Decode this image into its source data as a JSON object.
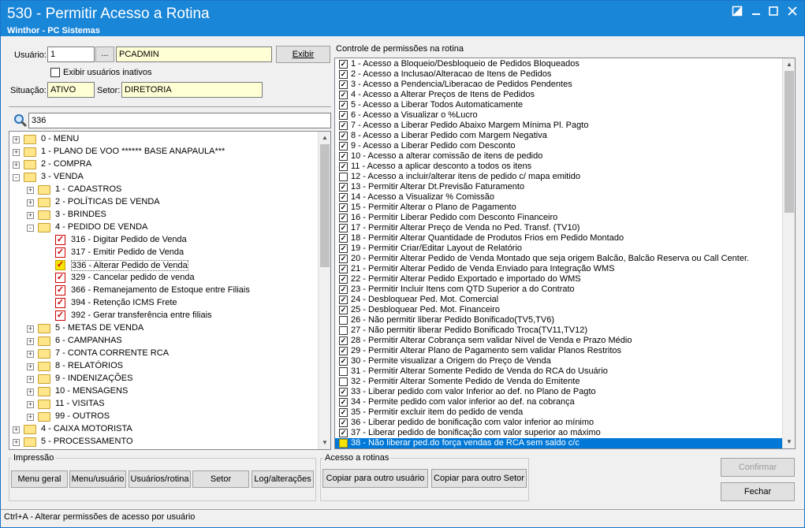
{
  "window": {
    "title": "530 - Permitir Acesso a Rotina",
    "subtitle": "Winthor - PC Sistemas"
  },
  "form": {
    "usuario_label": "Usuário:",
    "usuario_value": "1",
    "lookup_label": "...",
    "usuario_name": "PCADMIN",
    "exibir_label": "Exibir",
    "exibir_inativos_label": "Exibir usuários inativos",
    "situacao_label": "Situação:",
    "situacao_value": "ATIVO",
    "setor_label": "Setor:",
    "setor_value": "DIRETORIA",
    "search_value": "336"
  },
  "tree": [
    {
      "label": "0 - MENU",
      "level": 0,
      "type": "folder",
      "exp": "+"
    },
    {
      "label": "1 - PLANO DE VOO   ****** BASE ANAPAULA***",
      "level": 0,
      "type": "folder",
      "exp": "+"
    },
    {
      "label": "2 - COMPRA",
      "level": 0,
      "type": "folder",
      "exp": "+"
    },
    {
      "label": "3 - VENDA",
      "level": 0,
      "type": "folder",
      "exp": "-"
    },
    {
      "label": "1 - CADASTROS",
      "level": 1,
      "type": "folder",
      "exp": "+"
    },
    {
      "label": "2 - POLÍTICAS DE VENDA",
      "level": 1,
      "type": "folder",
      "exp": "+"
    },
    {
      "label": "3 - BRINDES",
      "level": 1,
      "type": "folder",
      "exp": "+"
    },
    {
      "label": "4 - PEDIDO DE VENDA",
      "level": 1,
      "type": "folder",
      "exp": "-"
    },
    {
      "label": "316 - Digitar Pedido de Venda",
      "level": 2,
      "type": "check"
    },
    {
      "label": "317 - Emitir Pedido de Venda",
      "level": 2,
      "type": "check"
    },
    {
      "label": "336 - Alterar Pedido de Venda",
      "level": 2,
      "type": "check",
      "sel": true
    },
    {
      "label": "329 - Cancelar pedido de venda",
      "level": 2,
      "type": "check"
    },
    {
      "label": "366 - Remanejamento de Estoque entre Filiais",
      "level": 2,
      "type": "check"
    },
    {
      "label": "394 - Retenção ICMS Frete",
      "level": 2,
      "type": "check"
    },
    {
      "label": "392 - Gerar transferência entre filiais",
      "level": 2,
      "type": "check"
    },
    {
      "label": "5 - METAS DE VENDA",
      "level": 1,
      "type": "folder",
      "exp": "+"
    },
    {
      "label": "6 - CAMPANHAS",
      "level": 1,
      "type": "folder",
      "exp": "+"
    },
    {
      "label": "7 - CONTA CORRENTE RCA",
      "level": 1,
      "type": "folder",
      "exp": "+"
    },
    {
      "label": "8 - RELATÓRIOS",
      "level": 1,
      "type": "folder",
      "exp": "+"
    },
    {
      "label": "9 - INDENIZAÇÕES",
      "level": 1,
      "type": "folder",
      "exp": "+"
    },
    {
      "label": "10 - MENSAGENS",
      "level": 1,
      "type": "folder",
      "exp": "+"
    },
    {
      "label": "11 - VISITAS",
      "level": 1,
      "type": "folder",
      "exp": "+"
    },
    {
      "label": "99 - OUTROS",
      "level": 1,
      "type": "folder",
      "exp": "+"
    },
    {
      "label": "4 - CAIXA MOTORISTA",
      "level": 0,
      "type": "folder",
      "exp": "+"
    },
    {
      "label": "5 - PROCESSAMENTO",
      "level": 0,
      "type": "folder",
      "exp": "+"
    }
  ],
  "permissions_title": "Controle de permissões na rotina",
  "permissions": [
    {
      "label": "1 - Acesso a Bloqueio/Desbloqueio de Pedidos Bloqueados",
      "checked": true
    },
    {
      "label": "2 - Acesso a Inclusao/Alteracao de Itens de Pedidos",
      "checked": true
    },
    {
      "label": "3 - Acesso a Pendencia/Liberacao de Pedidos Pendentes",
      "checked": true
    },
    {
      "label": "4 - Acesso a Alterar Preços de Itens de Pedidos",
      "checked": true
    },
    {
      "label": "5 - Acesso a Liberar Todos Automaticamente",
      "checked": true
    },
    {
      "label": "6 - Acesso a Visualizar o %Lucro",
      "checked": true
    },
    {
      "label": "7 - Acesso a Liberar Pedido Abaixo Margem Mínima Pl. Pagto",
      "checked": true
    },
    {
      "label": "8 - Acesso a Liberar Pedido com Margem Negativa",
      "checked": true
    },
    {
      "label": "9 - Acesso a Liberar Pedido com Desconto",
      "checked": true
    },
    {
      "label": "10 - Acesso a alterar comissão de itens de pedido",
      "checked": true
    },
    {
      "label": "11 - Acesso a aplicar desconto a todos os itens",
      "checked": true
    },
    {
      "label": "12 - Acesso a incluir/alterar itens de pedido c/ mapa emitido",
      "checked": false
    },
    {
      "label": "13 - Permitir Alterar Dt.Previsão Faturamento",
      "checked": true
    },
    {
      "label": "14 - Acesso a Visualizar % Comissão",
      "checked": true
    },
    {
      "label": "15 - Permitir Alterar o Plano de Pagamento",
      "checked": true
    },
    {
      "label": "16 - Permitir Liberar Pedido com Desconto Financeiro",
      "checked": true
    },
    {
      "label": "17 - Permitir Alterar Preço de Venda no Ped. Transf. (TV10)",
      "checked": true
    },
    {
      "label": "18 - Permitir Alterar Quantidade de Produtos Frios em Pedido Montado",
      "checked": true
    },
    {
      "label": "19 - Permitir Criar/Editar Layout de Relatório",
      "checked": true
    },
    {
      "label": "20 - Permitir Alterar Pedido de Venda Montado que seja origem Balcão, Balcão Reserva ou Call Center.",
      "checked": true
    },
    {
      "label": "21 - Permitir Alterar Pedido de Venda Enviado para Integração WMS",
      "checked": true
    },
    {
      "label": "22 - Permitir Alterar Pedido Exportado e importado do WMS",
      "checked": true
    },
    {
      "label": "23 - Permitir Incluir Itens com QTD Superior a do Contrato",
      "checked": true
    },
    {
      "label": "24 - Desbloquear Ped. Mot. Comercial",
      "checked": true
    },
    {
      "label": "25 - Desbloquear Ped. Mot. Financeiro",
      "checked": true
    },
    {
      "label": "26 - Não permitir liberar Pedido Bonificado(TV5,TV6)",
      "checked": false
    },
    {
      "label": "27 - Não permitir liberar Pedido Bonificado Troca(TV11,TV12)",
      "checked": false
    },
    {
      "label": "28 - Permitir Alterar Cobrança sem validar Nível de Venda e Prazo Médio",
      "checked": true
    },
    {
      "label": "29 - Permitir Alterar Plano de Pagamento sem validar Planos Restritos",
      "checked": true
    },
    {
      "label": "30 - Permite visualizar a Origem do Preço de Venda",
      "checked": true
    },
    {
      "label": "31 - Permitir Alterar Somente Pedido de Venda do RCA do Usuário",
      "checked": false
    },
    {
      "label": "32 - Permitir Alterar Somente Pedido de Venda do Emitente",
      "checked": false
    },
    {
      "label": "33 - Liberar pedido com valor Inferior ao def. no Plano de Pagto",
      "checked": true
    },
    {
      "label": "34 - Permite pedido com valor inferior ao def. na cobrança",
      "checked": true
    },
    {
      "label": "35 - Permitir excluir item do pedido de venda",
      "checked": true
    },
    {
      "label": "36 - Liberar pedido de bonificação com valor inferior ao mínimo",
      "checked": true
    },
    {
      "label": "37 - Liberar pedido de bonificação com valor superior ao máximo",
      "checked": true
    },
    {
      "label": "38 - Não liberar ped.do força vendas de RCA sem saldo c/c",
      "checked": false,
      "selected": true
    }
  ],
  "impressao": {
    "title": "Impressão",
    "buttons": [
      "Menu geral",
      "Menu/usuário",
      "Usuários/rotina",
      "Setor",
      "Log/alterações"
    ]
  },
  "acesso": {
    "title": "Acesso a rotinas",
    "buttons": [
      "Copiar para outro usuário",
      "Copiar para outro Setor"
    ]
  },
  "actions": {
    "confirmar": "Confirmar",
    "fechar": "Fechar"
  },
  "status": "Ctrl+A - Alterar permissões de acesso por usuário"
}
